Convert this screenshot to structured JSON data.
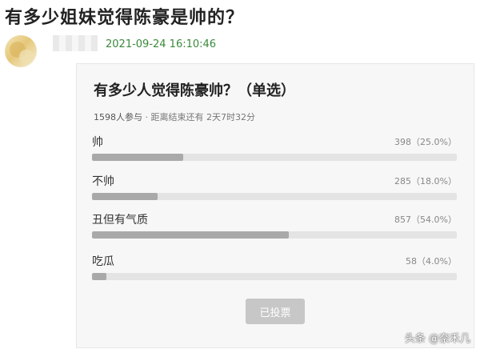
{
  "post": {
    "title": "有多少姐妹觉得陈豪是帅的？",
    "timestamp": "2021-09-24 16:10:46"
  },
  "poll": {
    "title": "有多少人觉得陈豪帅？（单选）",
    "participants": "1598人参与",
    "separator": " · ",
    "deadline": "距离结束还有 2天7时32分",
    "options": [
      {
        "label": "帅",
        "stats": "398（25.0%）",
        "percent": 25.0
      },
      {
        "label": "不帅",
        "stats": "285（18.0%）",
        "percent": 18.0
      },
      {
        "label": "丑但有气质",
        "stats": "857（54.0%）",
        "percent": 54.0
      },
      {
        "label": "吃瓜",
        "stats": "58（4.0%）",
        "percent": 4.0
      }
    ],
    "voted_button": "已投票"
  },
  "watermark": "头条 @奈禾几",
  "colors": {
    "timestamp": "#3a8a3a",
    "bar_fill": "#a9a9a9",
    "bar_track": "#e4e4e4",
    "button_disabled": "#c7c7c7"
  }
}
